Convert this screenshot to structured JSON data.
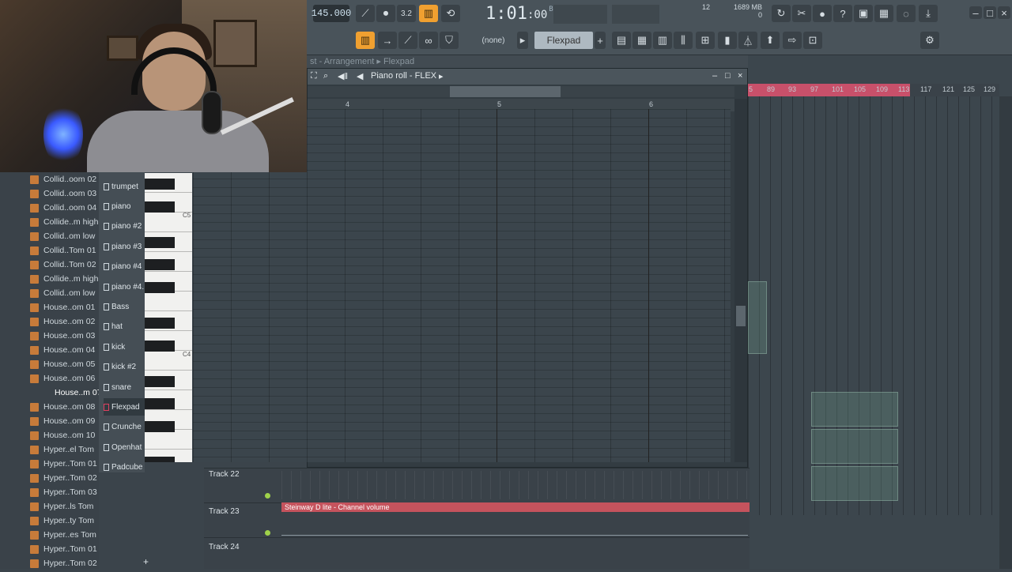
{
  "toolbar": {
    "tempo": "145.000",
    "time": "1:01",
    "time_sub": ":00",
    "time_label": "B:S:T",
    "cpu_value": "12",
    "memory": "1689 MB",
    "polyphony": "0",
    "pattern_select": "(none)",
    "flexpad_label": "Flexpad"
  },
  "playlist": {
    "breadcrumb": "st - Arrangement ▸ Flexpad",
    "ruler": [
      "5",
      "89",
      "93",
      "97",
      "101",
      "105",
      "109",
      "113",
      "117",
      "121",
      "125",
      "129"
    ]
  },
  "pianoroll": {
    "title": "Piano roll - FLEX",
    "ruler": [
      "4",
      "5",
      "6"
    ],
    "c5_label": "C5",
    "c4_label": "C4"
  },
  "browser": {
    "items": [
      "Collid..oom 02",
      "Collid..oom 03",
      "Collid..oom 04",
      "Collide..m high",
      "Collid..om low",
      "Collid..Tom 01",
      "Collid..Tom 02",
      "Collide..m high",
      "Collid..om low",
      "House..om 01",
      "House..om 02",
      "House..om 03",
      "House..om 04",
      "House..om 05",
      "House..om 06",
      "House..m 07",
      "House..om 08",
      "House..om 09",
      "House..om 10",
      "Hyper..el Tom",
      "Hyper..Tom 01",
      "Hyper..Tom 02",
      "Hyper..Tom 03",
      "Hyper..ls Tom",
      "Hyper..ty Tom",
      "Hyper..es Tom",
      "Hyper..Tom 01",
      "Hyper..Tom 02"
    ]
  },
  "channels": {
    "items": [
      "trumpet",
      "piano",
      "piano #2",
      "piano #3",
      "piano #4",
      "piano #4.",
      "Bass",
      "hat",
      "kick",
      "kick #2",
      "snare",
      "Flexpad",
      "Crunche",
      "Openhat",
      "Padcube"
    ]
  },
  "tracks": {
    "track22": "Track 22",
    "track23": "Track 23",
    "track24": "Track 24",
    "automation_clip": "Steinway D lite - Channel volume"
  }
}
